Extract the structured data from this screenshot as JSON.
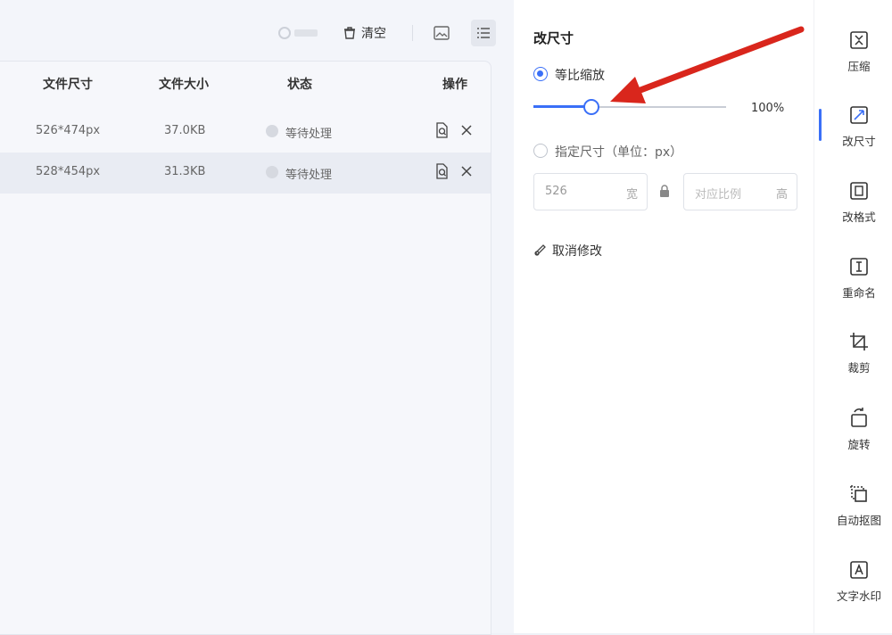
{
  "toolbar": {
    "clear_label": "清空",
    "icons": [
      "history-icon",
      "trash-icon",
      "image-view-icon",
      "list-view-icon"
    ]
  },
  "file_list": {
    "columns": [
      "文件尺寸",
      "文件大小",
      "状态",
      "操作"
    ],
    "rows": [
      {
        "dimensions": "526*474px",
        "size": "37.0KB",
        "status": "等待处理"
      },
      {
        "dimensions": "528*454px",
        "size": "31.3KB",
        "status": "等待处理"
      }
    ]
  },
  "settings": {
    "title": "改尺寸",
    "proportional_label": "等比缩放",
    "proportional_selected": true,
    "scale_value": "100%",
    "scale_fraction": 0.3,
    "custom_label": "指定尺寸（单位：px）",
    "width_value": "526",
    "width_unit": "宽",
    "height_placeholder": "对应比例",
    "height_unit": "高",
    "cancel_label": "取消修改"
  },
  "tools": [
    {
      "label": "压缩",
      "icon": "compress-icon"
    },
    {
      "label": "改尺寸",
      "icon": "resize-icon",
      "active": true
    },
    {
      "label": "改格式",
      "icon": "format-icon"
    },
    {
      "label": "重命名",
      "icon": "rename-icon"
    },
    {
      "label": "裁剪",
      "icon": "crop-icon"
    },
    {
      "label": "旋转",
      "icon": "rotate-icon"
    },
    {
      "label": "自动抠图",
      "icon": "cutout-icon"
    },
    {
      "label": "文字水印",
      "icon": "text-watermark-icon"
    }
  ],
  "colors": {
    "accent": "#3a6ff7",
    "annotation_arrow": "#d9261c"
  }
}
